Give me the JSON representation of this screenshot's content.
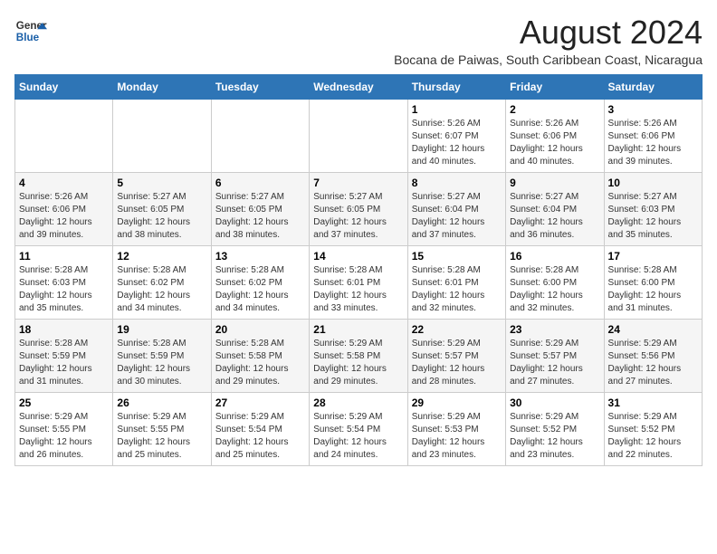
{
  "logo": {
    "line1": "General",
    "line2": "Blue"
  },
  "title": "August 2024",
  "location": "Bocana de Paiwas, South Caribbean Coast, Nicaragua",
  "days_header": [
    "Sunday",
    "Monday",
    "Tuesday",
    "Wednesday",
    "Thursday",
    "Friday",
    "Saturday"
  ],
  "weeks": [
    [
      {
        "num": "",
        "info": ""
      },
      {
        "num": "",
        "info": ""
      },
      {
        "num": "",
        "info": ""
      },
      {
        "num": "",
        "info": ""
      },
      {
        "num": "1",
        "info": "Sunrise: 5:26 AM\nSunset: 6:07 PM\nDaylight: 12 hours\nand 40 minutes."
      },
      {
        "num": "2",
        "info": "Sunrise: 5:26 AM\nSunset: 6:06 PM\nDaylight: 12 hours\nand 40 minutes."
      },
      {
        "num": "3",
        "info": "Sunrise: 5:26 AM\nSunset: 6:06 PM\nDaylight: 12 hours\nand 39 minutes."
      }
    ],
    [
      {
        "num": "4",
        "info": "Sunrise: 5:26 AM\nSunset: 6:06 PM\nDaylight: 12 hours\nand 39 minutes."
      },
      {
        "num": "5",
        "info": "Sunrise: 5:27 AM\nSunset: 6:05 PM\nDaylight: 12 hours\nand 38 minutes."
      },
      {
        "num": "6",
        "info": "Sunrise: 5:27 AM\nSunset: 6:05 PM\nDaylight: 12 hours\nand 38 minutes."
      },
      {
        "num": "7",
        "info": "Sunrise: 5:27 AM\nSunset: 6:05 PM\nDaylight: 12 hours\nand 37 minutes."
      },
      {
        "num": "8",
        "info": "Sunrise: 5:27 AM\nSunset: 6:04 PM\nDaylight: 12 hours\nand 37 minutes."
      },
      {
        "num": "9",
        "info": "Sunrise: 5:27 AM\nSunset: 6:04 PM\nDaylight: 12 hours\nand 36 minutes."
      },
      {
        "num": "10",
        "info": "Sunrise: 5:27 AM\nSunset: 6:03 PM\nDaylight: 12 hours\nand 35 minutes."
      }
    ],
    [
      {
        "num": "11",
        "info": "Sunrise: 5:28 AM\nSunset: 6:03 PM\nDaylight: 12 hours\nand 35 minutes."
      },
      {
        "num": "12",
        "info": "Sunrise: 5:28 AM\nSunset: 6:02 PM\nDaylight: 12 hours\nand 34 minutes."
      },
      {
        "num": "13",
        "info": "Sunrise: 5:28 AM\nSunset: 6:02 PM\nDaylight: 12 hours\nand 34 minutes."
      },
      {
        "num": "14",
        "info": "Sunrise: 5:28 AM\nSunset: 6:01 PM\nDaylight: 12 hours\nand 33 minutes."
      },
      {
        "num": "15",
        "info": "Sunrise: 5:28 AM\nSunset: 6:01 PM\nDaylight: 12 hours\nand 32 minutes."
      },
      {
        "num": "16",
        "info": "Sunrise: 5:28 AM\nSunset: 6:00 PM\nDaylight: 12 hours\nand 32 minutes."
      },
      {
        "num": "17",
        "info": "Sunrise: 5:28 AM\nSunset: 6:00 PM\nDaylight: 12 hours\nand 31 minutes."
      }
    ],
    [
      {
        "num": "18",
        "info": "Sunrise: 5:28 AM\nSunset: 5:59 PM\nDaylight: 12 hours\nand 31 minutes."
      },
      {
        "num": "19",
        "info": "Sunrise: 5:28 AM\nSunset: 5:59 PM\nDaylight: 12 hours\nand 30 minutes."
      },
      {
        "num": "20",
        "info": "Sunrise: 5:28 AM\nSunset: 5:58 PM\nDaylight: 12 hours\nand 29 minutes."
      },
      {
        "num": "21",
        "info": "Sunrise: 5:29 AM\nSunset: 5:58 PM\nDaylight: 12 hours\nand 29 minutes."
      },
      {
        "num": "22",
        "info": "Sunrise: 5:29 AM\nSunset: 5:57 PM\nDaylight: 12 hours\nand 28 minutes."
      },
      {
        "num": "23",
        "info": "Sunrise: 5:29 AM\nSunset: 5:57 PM\nDaylight: 12 hours\nand 27 minutes."
      },
      {
        "num": "24",
        "info": "Sunrise: 5:29 AM\nSunset: 5:56 PM\nDaylight: 12 hours\nand 27 minutes."
      }
    ],
    [
      {
        "num": "25",
        "info": "Sunrise: 5:29 AM\nSunset: 5:55 PM\nDaylight: 12 hours\nand 26 minutes."
      },
      {
        "num": "26",
        "info": "Sunrise: 5:29 AM\nSunset: 5:55 PM\nDaylight: 12 hours\nand 25 minutes."
      },
      {
        "num": "27",
        "info": "Sunrise: 5:29 AM\nSunset: 5:54 PM\nDaylight: 12 hours\nand 25 minutes."
      },
      {
        "num": "28",
        "info": "Sunrise: 5:29 AM\nSunset: 5:54 PM\nDaylight: 12 hours\nand 24 minutes."
      },
      {
        "num": "29",
        "info": "Sunrise: 5:29 AM\nSunset: 5:53 PM\nDaylight: 12 hours\nand 23 minutes."
      },
      {
        "num": "30",
        "info": "Sunrise: 5:29 AM\nSunset: 5:52 PM\nDaylight: 12 hours\nand 23 minutes."
      },
      {
        "num": "31",
        "info": "Sunrise: 5:29 AM\nSunset: 5:52 PM\nDaylight: 12 hours\nand 22 minutes."
      }
    ]
  ]
}
